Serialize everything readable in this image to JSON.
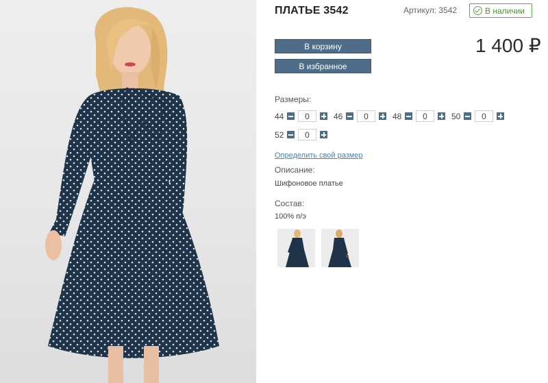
{
  "product": {
    "title": "ПЛАТЬЕ 3542",
    "sku": "Артикул: 3542",
    "stock": "В наличии",
    "price": "1 400 ₽"
  },
  "actions": {
    "cart": "В корзину",
    "favorite": "В избранное"
  },
  "sizes": {
    "label": "Размеры:",
    "items": [
      {
        "size": "44",
        "qty": "0"
      },
      {
        "size": "46",
        "qty": "0"
      },
      {
        "size": "48",
        "qty": "0"
      },
      {
        "size": "50",
        "qty": "0"
      },
      {
        "size": "52",
        "qty": "0"
      }
    ],
    "size_link": "Определить свой размер"
  },
  "description": {
    "label": "Описание:",
    "text": "Шифоновое платье"
  },
  "composition": {
    "label": "Состав:",
    "text": "100% п/э"
  },
  "colors": {
    "button": "#4d6d88",
    "stock": "#5aa43a",
    "dress": "#1f3448",
    "link": "#4d7ea8"
  }
}
